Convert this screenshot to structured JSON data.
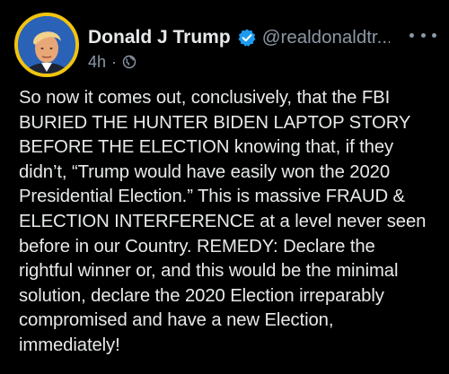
{
  "tweet": {
    "author": {
      "display_name": "Donald J Trump",
      "handle": "@realdonaldtr...",
      "avatar_ring_color": "#f1c40f",
      "verified_color": "#1d9bf0"
    },
    "timestamp": "4h",
    "separator": "·",
    "visibility_icon": "globe-icon",
    "more_icon": "more-options-icon",
    "text": "So now it comes out, conclusively, that the FBI\nBURIED THE HUNTER BIDEN LAPTOP STORY\nBEFORE THE ELECTION knowing that, if they\ndidn’t, “Trump would have easily won the 2020\nPresidential Election.” This is massive FRAUD &\nELECTION INTERFERENCE at a level never seen\nbefore in our Country. REMEDY: Declare the\nrightful winner or, and this would be the minimal\nsolution, declare the 2020 Election irreparably\ncompromised and have a new Election,\nimmediately!"
  }
}
